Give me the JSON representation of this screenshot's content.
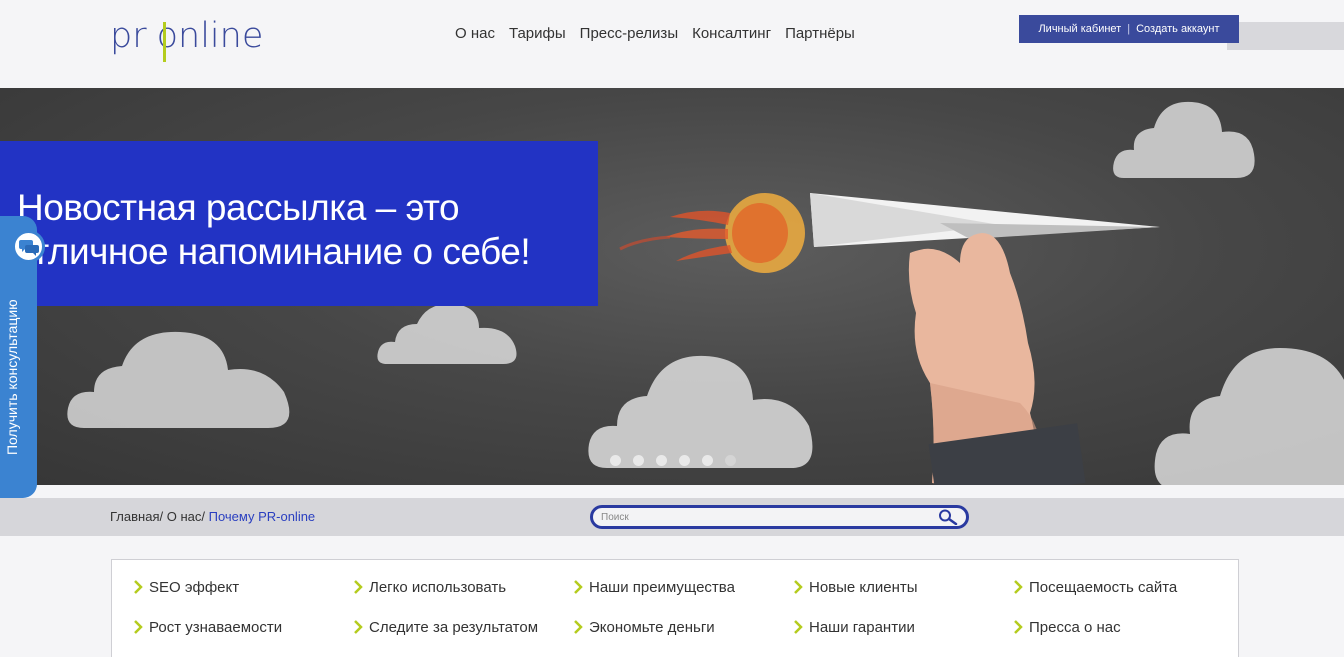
{
  "header": {
    "logo": {
      "left": "pr",
      "right": "online"
    },
    "nav": [
      "О нас",
      "Тарифы",
      "Пресс-релизы",
      "Консалтинг",
      "Партнёры"
    ],
    "account": {
      "login": "Личный кабинет",
      "separator": "|",
      "register": "Создать аккаунт"
    },
    "colors": {
      "brand": "#3a4a9c",
      "accent": "#b4cc1e"
    }
  },
  "banner": {
    "headline_line1": "Новостная рассылка – это",
    "headline_line2": "отличное напоминание о себе!",
    "slides_total": 6,
    "active_slide": 1,
    "box_color": "#2233c4"
  },
  "consult": {
    "label": "Получить консультацию",
    "icon": "chat-bubbles-icon",
    "color": "#3b83d1"
  },
  "breadcrumb": {
    "home": "Главная",
    "sep1": "/ ",
    "about": "О нас",
    "sep2": "/ ",
    "current": "Почему PR-online"
  },
  "search": {
    "placeholder": "Поиск",
    "icon": "search-icon"
  },
  "links": [
    "SEO эффект",
    "Легко использовать",
    "Наши преимущества",
    "Новые клиенты",
    "Посещаемость сайта",
    "Рост узнаваемости",
    "Следите за результатом",
    "Экономьте деньги",
    "Наши гарантии",
    "Пресса о нас"
  ]
}
